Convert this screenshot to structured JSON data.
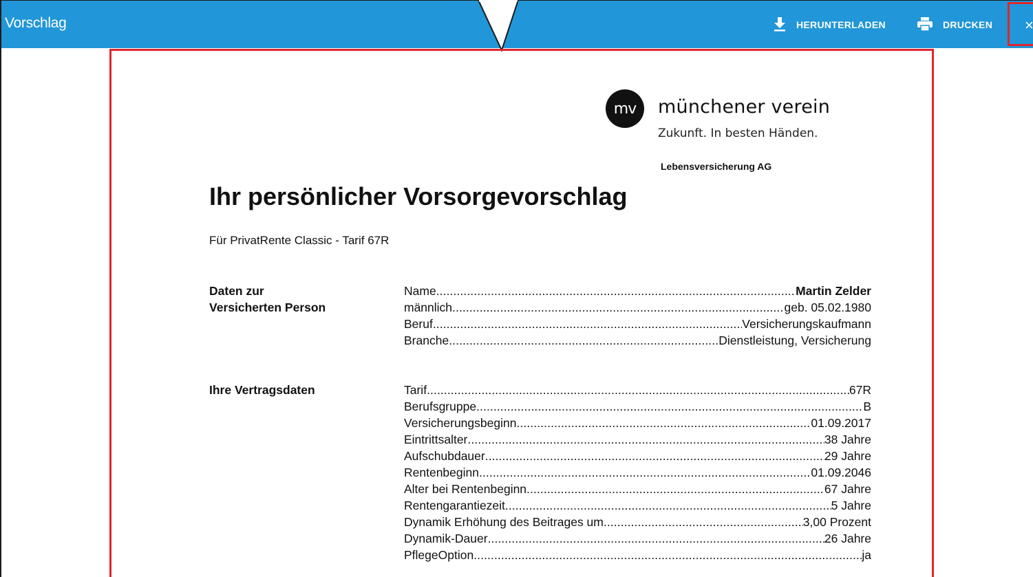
{
  "header": {
    "title": "Vorschlag",
    "download_label": "HERUNTERLADEN",
    "print_label": "DRUCKEN",
    "close_label": "×",
    "download_icon": "download-icon",
    "print_icon": "printer-icon",
    "close_icon": "close-icon",
    "accent_color": "#2196d8",
    "highlight_color": "#e0252b"
  },
  "document": {
    "logo": {
      "mark": "mv",
      "name": "münchener verein",
      "claim": "Zukunft. In besten Händen."
    },
    "company": "Lebensversicherung AG",
    "title": "Ihr persönlicher Vorsorgevorschlag",
    "subtitle": "Für PrivatRente Classic - Tarif 67R",
    "person_section": {
      "label_line1": "Daten zur",
      "label_line2": "Versicherten Person",
      "rows": [
        {
          "key": "Name",
          "value": "Martin Zelder"
        },
        {
          "key": "männlich",
          "value": "geb. 05.02.1980"
        },
        {
          "key": "Beruf",
          "value": "Versicherungskaufmann"
        },
        {
          "key": "Branche",
          "value": "Dienstleistung, Versicherung"
        }
      ]
    },
    "contract_section": {
      "label": "Ihre Vertragsdaten",
      "rows": [
        {
          "key": "Tarif",
          "value": "67R"
        },
        {
          "key": "Berufsgruppe",
          "value": "B"
        },
        {
          "key": "Versicherungsbeginn",
          "value": "01.09.2017"
        },
        {
          "key": "Eintrittsalter",
          "value": "38 Jahre"
        },
        {
          "key": "Aufschubdauer",
          "value": "29 Jahre"
        },
        {
          "key": "Rentenbeginn",
          "value": "01.09.2046"
        },
        {
          "key": "Alter bei Rentenbeginn",
          "value": "67 Jahre"
        },
        {
          "key": "Rentengarantiezeit",
          "value": "5 Jahre"
        },
        {
          "key": "Dynamik Erhöhung des Beitrages um",
          "value": "3,00 Prozent"
        },
        {
          "key": "Dynamik-Dauer",
          "value": "26 Jahre"
        },
        {
          "key": "PflegeOption",
          "value": "ja"
        }
      ]
    }
  }
}
